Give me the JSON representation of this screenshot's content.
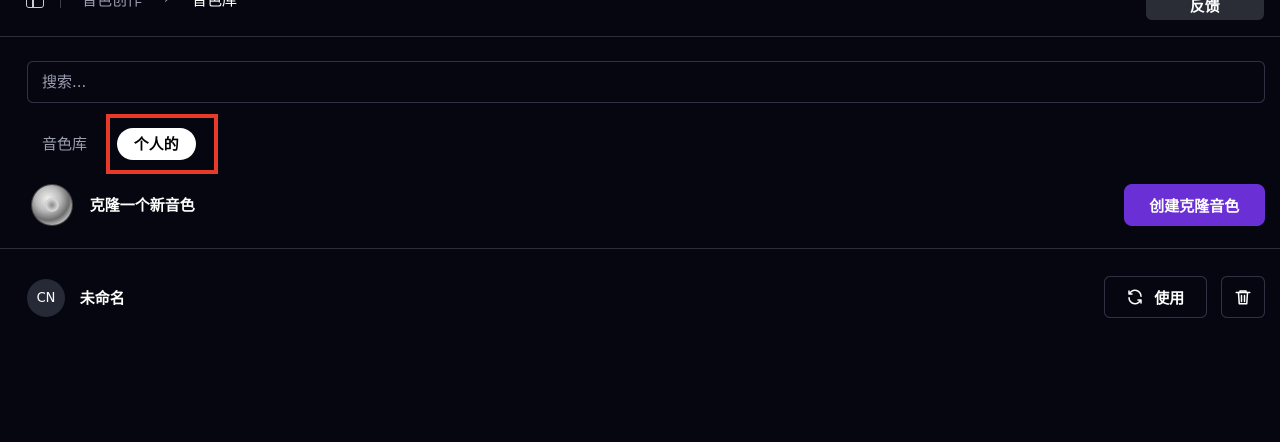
{
  "header": {
    "breadcrumb": [
      "音色创作",
      "音色库"
    ],
    "breadcrumb_separator": "›",
    "feedback_label": "反馈",
    "sidebar_toggle_icon": "sidebar-icon"
  },
  "search": {
    "placeholder": "搜索..."
  },
  "tabs": [
    {
      "label": "音色库",
      "active": false
    },
    {
      "label": "个人的",
      "active": true
    }
  ],
  "clone": {
    "label": "克隆一个新音色",
    "button_label": "创建克隆音色"
  },
  "voices": [
    {
      "initials": "CN",
      "name": "未命名",
      "use_label": "使用"
    }
  ],
  "colors": {
    "background": "#05060f",
    "accent": "#6b2fd6",
    "highlight": "#e63a2a"
  }
}
